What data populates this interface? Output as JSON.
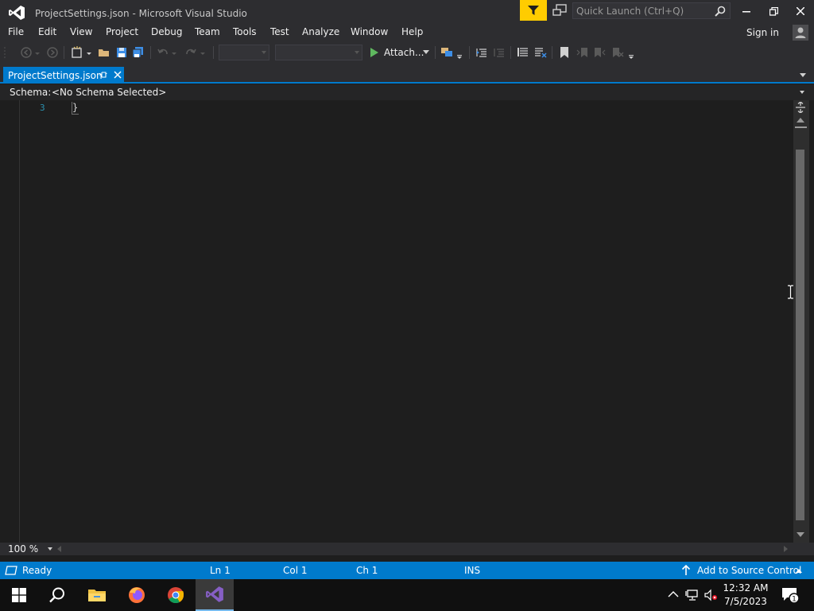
{
  "window": {
    "title": "ProjectSettings.json - Microsoft Visual Studio",
    "quick_launch_placeholder": "Quick Launch (Ctrl+Q)"
  },
  "menu": {
    "items": [
      "File",
      "Edit",
      "View",
      "Project",
      "Debug",
      "Team",
      "Tools",
      "Test",
      "Analyze",
      "Window",
      "Help"
    ],
    "sign_in": "Sign in"
  },
  "toolbar": {
    "attach_label": "Attach..."
  },
  "tabs": [
    {
      "label": "ProjectSettings.json",
      "active": true
    }
  ],
  "schema": {
    "label": "Schema:",
    "value": "<No Schema Selected>"
  },
  "editor": {
    "lines": [
      {
        "number": "3",
        "text": "}"
      }
    ]
  },
  "zoom": "100 %",
  "status": {
    "ready": "Ready",
    "line": "Ln 1",
    "col": "Col 1",
    "ch": "Ch 1",
    "mode": "INS",
    "source_control": "Add to Source Control"
  },
  "clock": {
    "time": "12:32 AM",
    "date": "7/5/2023"
  },
  "colors": {
    "accent": "#007acc",
    "filter": "#ffcc00",
    "vs_purple": "#865fc5"
  }
}
